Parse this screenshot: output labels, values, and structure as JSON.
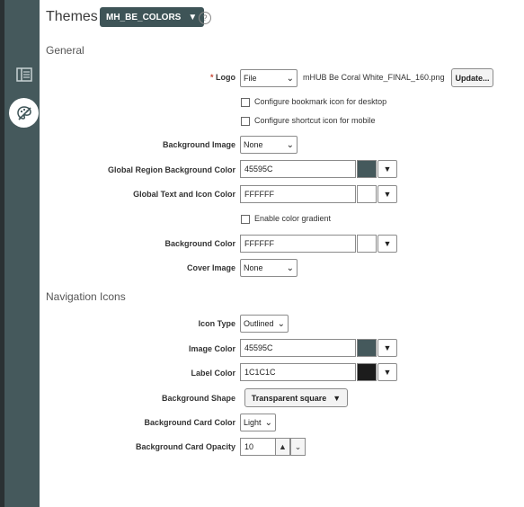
{
  "header": {
    "title": "Themes",
    "theme_selector": "MH_BE_COLORS"
  },
  "rail": {
    "items": [
      "page-icon",
      "palette-icon"
    ]
  },
  "general": {
    "heading": "General",
    "logo": {
      "label": "Logo",
      "required": "*",
      "type": "File",
      "filename": "mHUB Be Coral White_FINAL_160.png",
      "update_label": "Update..."
    },
    "bookmark_checkbox": "Configure bookmark icon for desktop",
    "shortcut_checkbox": "Configure shortcut icon for mobile",
    "background_image": {
      "label": "Background Image",
      "value": "None"
    },
    "global_region_bg": {
      "label": "Global Region Background Color",
      "value": "45595C",
      "swatch": "#45595C"
    },
    "global_text_icon": {
      "label": "Global Text and Icon Color",
      "value": "FFFFFF",
      "swatch": "#FFFFFF"
    },
    "gradient_checkbox": "Enable color gradient",
    "background_color": {
      "label": "Background Color",
      "value": "FFFFFF",
      "swatch": "#FFFFFF"
    },
    "cover_image": {
      "label": "Cover Image",
      "value": "None"
    }
  },
  "nav": {
    "heading": "Navigation Icons",
    "icon_type": {
      "label": "Icon Type",
      "value": "Outlined"
    },
    "image_color": {
      "label": "Image Color",
      "value": "45595C",
      "swatch": "#45595C"
    },
    "label_color": {
      "label": "Label Color",
      "value": "1C1C1C",
      "swatch": "#1C1C1C"
    },
    "background_shape": {
      "label": "Background Shape",
      "value": "Transparent square"
    },
    "background_card_color": {
      "label": "Background Card Color",
      "value": "Light"
    },
    "background_card_opacity": {
      "label": "Background Card Opacity",
      "value": "10"
    }
  },
  "colors": {
    "rail": "#45595C",
    "rail_dark": "#2A3133",
    "button": "#3E5457"
  }
}
